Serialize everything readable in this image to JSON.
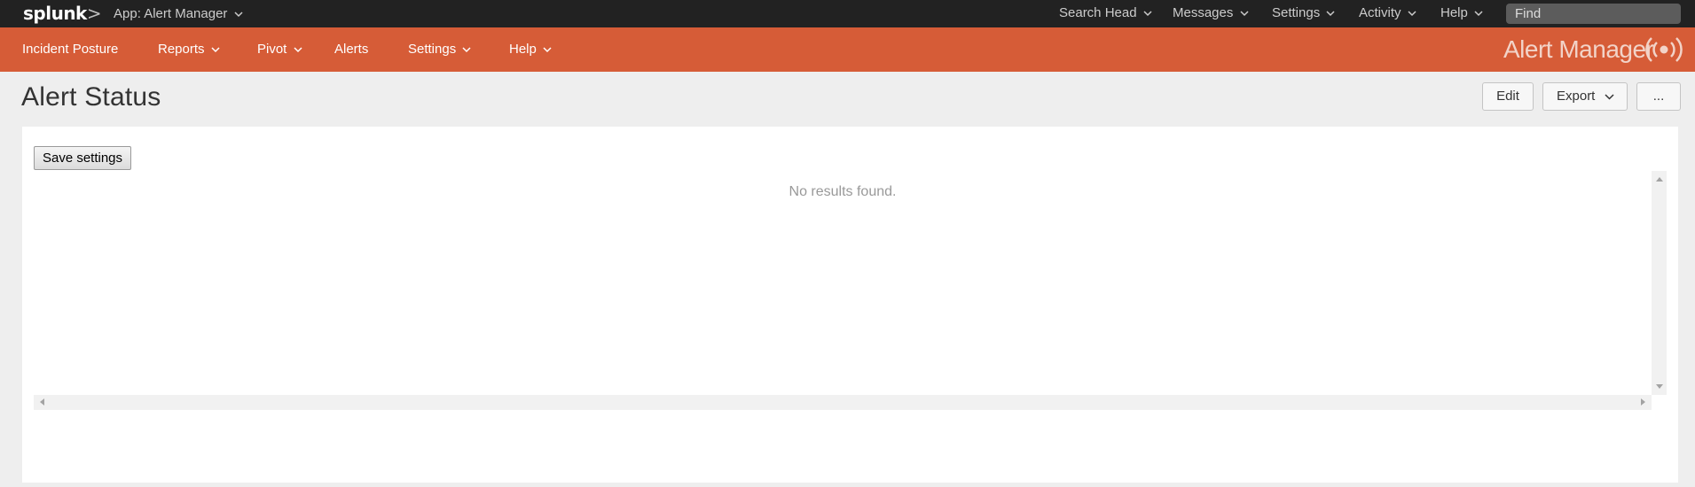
{
  "topbar": {
    "logo": "splunk",
    "logo_suffix": ">",
    "app_menu": "App: Alert Manager",
    "menus": [
      "Search Head",
      "Messages",
      "Settings",
      "Activity",
      "Help"
    ],
    "find_placeholder": "Find"
  },
  "appbar": {
    "nav": [
      "Incident Posture",
      "Reports",
      "Pivot",
      "Alerts",
      "Settings",
      "Help"
    ],
    "brand": "Alert Manager",
    "accent_color": "#d65c37"
  },
  "dashboard": {
    "title": "Alert Status",
    "edit_label": "Edit",
    "export_label": "Export",
    "more_label": "...",
    "save_label": "Save settings",
    "no_results": "No results found."
  }
}
